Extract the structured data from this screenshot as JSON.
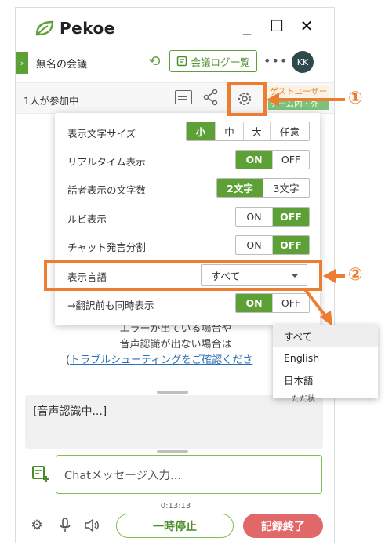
{
  "app": {
    "name": "Pekoe"
  },
  "window_controls": {
    "minimize": "_",
    "maximize": "☐",
    "close": "✕"
  },
  "meeting": {
    "title": "無名の会議",
    "log_button": "会議ログ一覧",
    "avatar_initials": "KK"
  },
  "participants": {
    "count_label": "1人が参加中",
    "guest_label_1": "ゲストユーザー",
    "guest_label_2": "チーム内・外"
  },
  "settings": {
    "font_size": {
      "label": "表示文字サイズ",
      "options": [
        "小",
        "中",
        "大",
        "任意"
      ],
      "selected": "小"
    },
    "realtime": {
      "label": "リアルタイム表示",
      "options": [
        "ON",
        "OFF"
      ],
      "selected": "ON"
    },
    "speaker_chars": {
      "label": "話者表示の文字数",
      "options": [
        "2文字",
        "3文字"
      ],
      "selected": "2文字"
    },
    "ruby": {
      "label": "ルビ表示",
      "options": [
        "ON",
        "OFF"
      ],
      "selected": "OFF"
    },
    "chat_split": {
      "label": "チャット発言分割",
      "options": [
        "ON",
        "OFF"
      ],
      "selected": "OFF"
    },
    "language": {
      "label": "表示言語",
      "value": "すべて"
    },
    "pre_translation": {
      "label": "→翻訳前も同時表示",
      "options": [
        "ON",
        "OFF"
      ],
      "selected": "ON"
    }
  },
  "language_dropdown": {
    "items": [
      "すべて",
      "English",
      "日本語"
    ],
    "selected": "すべて"
  },
  "background_text": {
    "line1": "エラーが出ている場合や",
    "line2": "音声認識が出ない場合は",
    "link_prefix": "(",
    "link": "トラブルシューティングをご確認くださ",
    "dropdown_peek": "ただ状"
  },
  "speech": {
    "status": "[音声認識中...]"
  },
  "chat": {
    "placeholder": "Chatメッセージ入力..."
  },
  "timer": "0:13:13",
  "controls": {
    "pause": "一時停止",
    "end": "記録終了"
  },
  "annotations": {
    "marker1": "①",
    "marker2": "②",
    "color": "#ed7d31"
  },
  "colors": {
    "accent": "#5da035",
    "end_button": "#e06868",
    "link": "#2a6fb5"
  }
}
